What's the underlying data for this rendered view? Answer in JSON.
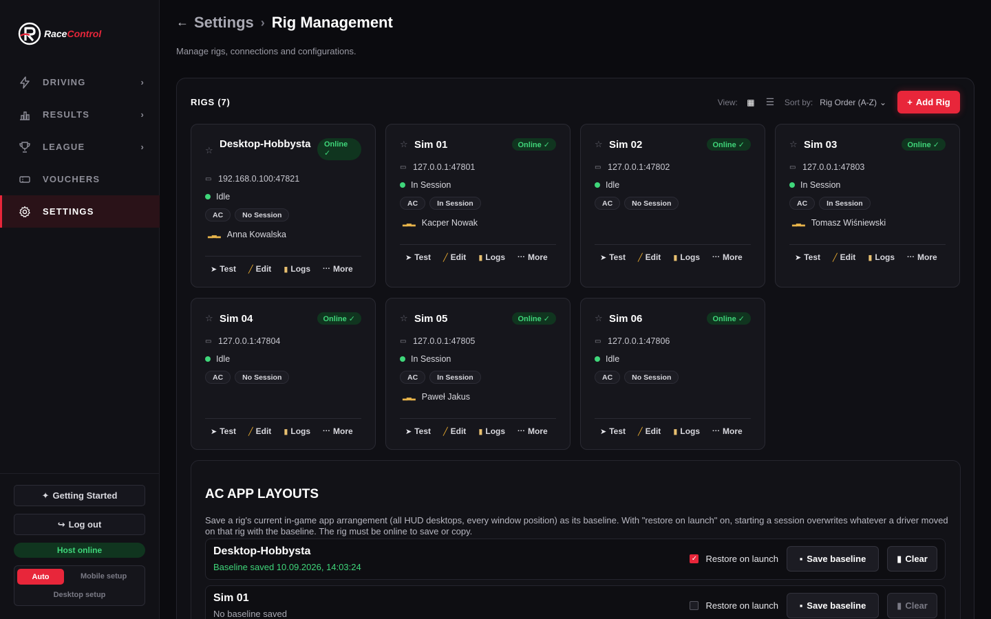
{
  "brand": {
    "name_part1": "Race",
    "name_part2": "Control",
    "accent": "#e8263a"
  },
  "sidebar": {
    "items": [
      {
        "label": "DRIVING",
        "icon": "lightning-icon",
        "has_chevron": true
      },
      {
        "label": "RESULTS",
        "icon": "bar-chart-icon",
        "has_chevron": true
      },
      {
        "label": "LEAGUE",
        "icon": "trophy-icon",
        "has_chevron": true
      },
      {
        "label": "VOUCHERS",
        "icon": "ticket-icon",
        "has_chevron": false
      },
      {
        "label": "SETTINGS",
        "icon": "gear-icon",
        "has_chevron": false,
        "active": true
      }
    ],
    "getting_started": "Getting Started",
    "log_out": "Log out",
    "host_status": "Host online",
    "modes": {
      "auto": "Auto",
      "mobile": "Mobile setup",
      "desktop": "Desktop setup"
    }
  },
  "header": {
    "crumb_parent": "Settings",
    "crumb_current": "Rig Management",
    "subtitle": "Manage rigs, connections and configurations."
  },
  "rigs": {
    "title": "RIGS (7)",
    "view_label": "View:",
    "sort_label": "Sort by:",
    "sort_value": "Rig Order (A-Z)",
    "add_label": "Add Rig",
    "cards": [
      {
        "name": "Desktop-Hobbysta",
        "status": "Online ✓",
        "ip": "192.168.0.100:47821",
        "state": "Idle",
        "game": "AC",
        "session": "No Session",
        "driver": "Anna Kowalska"
      },
      {
        "name": "Sim 01",
        "status": "Online ✓",
        "ip": "127.0.0.1:47801",
        "state": "In Session",
        "game": "AC",
        "session": "In Session",
        "driver": "Kacper Nowak"
      },
      {
        "name": "Sim 02",
        "status": "Online ✓",
        "ip": "127.0.0.1:47802",
        "state": "Idle",
        "game": "AC",
        "session": "No Session",
        "driver": ""
      },
      {
        "name": "Sim 03",
        "status": "Online ✓",
        "ip": "127.0.0.1:47803",
        "state": "In Session",
        "game": "AC",
        "session": "In Session",
        "driver": "Tomasz Wiśniewski"
      },
      {
        "name": "Sim 04",
        "status": "Online ✓",
        "ip": "127.0.0.1:47804",
        "state": "Idle",
        "game": "AC",
        "session": "No Session",
        "driver": ""
      },
      {
        "name": "Sim 05",
        "status": "Online ✓",
        "ip": "127.0.0.1:47805",
        "state": "In Session",
        "game": "AC",
        "session": "In Session",
        "driver": "Paweł Jakus"
      },
      {
        "name": "Sim 06",
        "status": "Online ✓",
        "ip": "127.0.0.1:47806",
        "state": "Idle",
        "game": "AC",
        "session": "No Session",
        "driver": ""
      }
    ],
    "actions": {
      "test": "Test",
      "edit": "Edit",
      "logs": "Logs",
      "more": "More"
    }
  },
  "ac_layouts": {
    "title": "AC APP LAYOUTS",
    "description": "Save a rig's current in-game app arrangement (all HUD desktops, every window position) as its baseline. With \"restore on launch\" on, starting a session overwrites whatever a driver moved on that rig with the baseline. The rig must be online to save or copy.",
    "restore_label": "Restore on launch",
    "save_label": "Save baseline",
    "clear_label": "Clear",
    "rows": [
      {
        "name": "Desktop-Hobbysta",
        "status": "Baseline saved 10.09.2026, 14:03:24",
        "saved": true,
        "restore": true
      },
      {
        "name": "Sim 01",
        "status": "No baseline saved",
        "saved": false,
        "restore": false
      }
    ]
  },
  "colors": {
    "online": "#3fd67a",
    "online_bg": "#10351f",
    "accent": "#e8263a"
  }
}
